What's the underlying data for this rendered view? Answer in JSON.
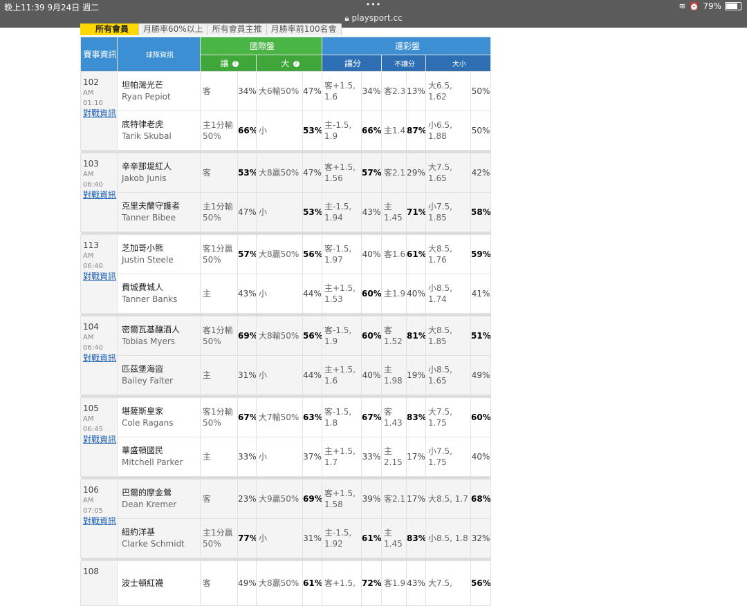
{
  "status_bar": {
    "time": "晚上11:39  9月24日 週二",
    "dots": "•••",
    "url": "playsport.cc",
    "battery": "79%",
    "battery_level": 0.79
  },
  "tabs": [
    "所有會員",
    "月勝率60%以上",
    "所有會員主推",
    "月勝率前100名會"
  ],
  "header": {
    "event_info": "賽事資訊",
    "team_info": "球隊資訊",
    "intl": "國際盤",
    "sport_lottery": "運彩盤",
    "spread": "讓",
    "total": "大",
    "lottery_spread": "讓分",
    "no_spread": "不讓分",
    "size": "大小",
    "help": "?"
  },
  "games": [
    {
      "id": "102",
      "ampm": "AM",
      "time": "01:10",
      "link": "對戰資訊",
      "teams": [
        {
          "cn": "坦帕灣光芒",
          "en": "Ryan Pepiot",
          "spread": "客",
          "spread_pct": "34%",
          "total": "大6輸50%",
          "total_pct": "47%",
          "ls": "客+1.5, 1.6",
          "ls_pct": "34%",
          "ns": "客2.3",
          "ns_pct": "13%",
          "sz": "大6.5, 1.62",
          "sz_pct": "50%"
        },
        {
          "cn": "底特律老虎",
          "en": "Tarik Skubal",
          "spread": "主1分輸50%",
          "spread_pct": "66%",
          "total": "小",
          "total_pct": "53%",
          "ls": "主-1.5, 1.9",
          "ls_pct": "66%",
          "ns": "主1.4",
          "ns_pct": "87%",
          "sz": "小6.5, 1.88",
          "sz_pct": "50%"
        }
      ]
    },
    {
      "id": "103",
      "ampm": "AM",
      "time": "06:40",
      "link": "對戰資訊",
      "teams": [
        {
          "cn": "辛辛那堤紅人",
          "en": "Jakob Junis",
          "spread": "客",
          "spread_pct": "53%",
          "total": "大8贏50%",
          "total_pct": "47%",
          "ls": "客+1.5, 1.56",
          "ls_pct": "57%",
          "ns": "客2.1",
          "ns_pct": "29%",
          "sz": "大7.5, 1.65",
          "sz_pct": "42%"
        },
        {
          "cn": "克里夫蘭守護者",
          "en": "Tanner Bibee",
          "spread": "主1分輸50%",
          "spread_pct": "47%",
          "total": "小",
          "total_pct": "53%",
          "ls": "主-1.5, 1.94",
          "ls_pct": "43%",
          "ns": "主 1.45",
          "ns_pct": "71%",
          "sz": "小7.5, 1.85",
          "sz_pct": "58%"
        }
      ]
    },
    {
      "id": "113",
      "ampm": "AM",
      "time": "06:40",
      "link": "對戰資訊",
      "teams": [
        {
          "cn": "芝加哥小熊",
          "en": "Justin Steele",
          "spread": "客1分贏50%",
          "spread_pct": "57%",
          "total": "大8贏50%",
          "total_pct": "56%",
          "ls": "客-1.5, 1.97",
          "ls_pct": "40%",
          "ns": "客1.6",
          "ns_pct": "61%",
          "sz": "大8.5, 1.76",
          "sz_pct": "59%"
        },
        {
          "cn": "費城費城人",
          "en": "Tanner Banks",
          "spread": "主",
          "spread_pct": "43%",
          "total": "小",
          "total_pct": "44%",
          "ls": "主+1.5, 1.53",
          "ls_pct": "60%",
          "ns": "主1.9",
          "ns_pct": "40%",
          "sz": "小8.5, 1.74",
          "sz_pct": "41%"
        }
      ]
    },
    {
      "id": "104",
      "ampm": "AM",
      "time": "06:40",
      "link": "對戰資訊",
      "teams": [
        {
          "cn": "密爾瓦基釀酒人",
          "en": "Tobias Myers",
          "spread": "客1分輸50%",
          "spread_pct": "69%",
          "total": "大8輸50%",
          "total_pct": "56%",
          "ls": "客-1.5, 1.9",
          "ls_pct": "60%",
          "ns": "客 1.52",
          "ns_pct": "81%",
          "sz": "大8.5, 1.85",
          "sz_pct": "51%"
        },
        {
          "cn": "匹茲堡海盜",
          "en": "Bailey Falter",
          "spread": "主",
          "spread_pct": "31%",
          "total": "小",
          "total_pct": "44%",
          "ls": "主+1.5, 1.6",
          "ls_pct": "40%",
          "ns": "主 1.98",
          "ns_pct": "19%",
          "sz": "小8.5, 1.65",
          "sz_pct": "49%"
        }
      ]
    },
    {
      "id": "105",
      "ampm": "AM",
      "time": "06:45",
      "link": "對戰資訊",
      "teams": [
        {
          "cn": "堪薩斯皇家",
          "en": "Cole Ragans",
          "spread": "客1分輸50%",
          "spread_pct": "67%",
          "total": "大7輸50%",
          "total_pct": "63%",
          "ls": "客-1.5, 1.8",
          "ls_pct": "67%",
          "ns": "客 1.43",
          "ns_pct": "83%",
          "sz": "大7.5, 1.75",
          "sz_pct": "60%"
        },
        {
          "cn": "華盛頓國民",
          "en": "Mitchell Parker",
          "spread": "主",
          "spread_pct": "33%",
          "total": "小",
          "total_pct": "37%",
          "ls": "主+1.5, 1.7",
          "ls_pct": "33%",
          "ns": "主 2.15",
          "ns_pct": "17%",
          "sz": "小7.5, 1.75",
          "sz_pct": "40%"
        }
      ]
    },
    {
      "id": "106",
      "ampm": "AM",
      "time": "07:05",
      "link": "對戰資訊",
      "teams": [
        {
          "cn": "巴爾的摩金鶯",
          "en": "Dean Kremer",
          "spread": "客",
          "spread_pct": "23%",
          "total": "大9贏50%",
          "total_pct": "69%",
          "ls": "客+1.5, 1.58",
          "ls_pct": "39%",
          "ns": "客2.1",
          "ns_pct": "17%",
          "sz": "大8.5, 1.7",
          "sz_pct": "68%"
        },
        {
          "cn": "紐約洋基",
          "en": "Clarke Schmidt",
          "spread": "主1分贏50%",
          "spread_pct": "77%",
          "total": "小",
          "total_pct": "31%",
          "ls": "主-1.5, 1.92",
          "ls_pct": "61%",
          "ns": "主 1.45",
          "ns_pct": "83%",
          "sz": "小8.5, 1.8",
          "sz_pct": "32%"
        }
      ]
    },
    {
      "id": "108",
      "ampm": "",
      "time": "",
      "link": "",
      "teams": [
        {
          "cn": "波士頓紅襪",
          "en": "",
          "spread": "客",
          "spread_pct": "49%",
          "total": "大8贏50%",
          "total_pct": "61%",
          "ls": "客+1.5,",
          "ls_pct": "72%",
          "ns": "客1.9",
          "ns_pct": "43%",
          "sz": "大7.5,",
          "sz_pct": "56%"
        }
      ]
    }
  ]
}
